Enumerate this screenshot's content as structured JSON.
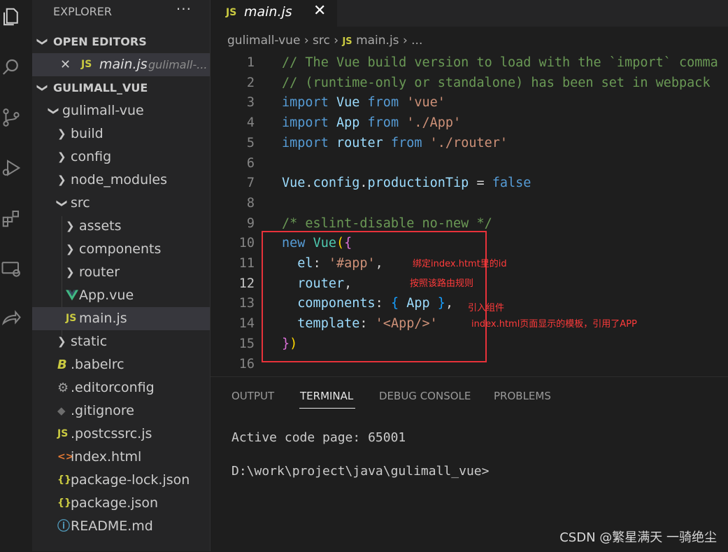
{
  "explorer": {
    "title": "EXPLORER",
    "more": "···",
    "open_editors_header": "OPEN EDITORS",
    "open_editor": {
      "icon": "JS",
      "name": "main.js",
      "path": "gulimall-..."
    },
    "project_header": "GULIMALL_VUE",
    "tree": [
      {
        "label": "gulimall-vue",
        "kind": "folder",
        "open": true
      },
      {
        "label": "build",
        "kind": "folder",
        "open": false
      },
      {
        "label": "config",
        "kind": "folder",
        "open": false
      },
      {
        "label": "node_modules",
        "kind": "folder",
        "open": false
      },
      {
        "label": "src",
        "kind": "folder",
        "open": true
      },
      {
        "label": "assets",
        "kind": "folder",
        "open": false
      },
      {
        "label": "components",
        "kind": "folder",
        "open": false
      },
      {
        "label": "router",
        "kind": "folder",
        "open": false
      },
      {
        "label": "App.vue",
        "kind": "file",
        "icon": "vue-icon"
      },
      {
        "label": "main.js",
        "kind": "file",
        "icon": "JS",
        "selected": true
      },
      {
        "label": "static",
        "kind": "folder",
        "open": false
      },
      {
        "label": ".babelrc",
        "kind": "file",
        "icon": "B"
      },
      {
        "label": ".editorconfig",
        "kind": "file",
        "icon": "gear-icon"
      },
      {
        "label": ".gitignore",
        "kind": "file",
        "icon": "git-icon"
      },
      {
        "label": ".postcssrc.js",
        "kind": "file",
        "icon": "JS"
      },
      {
        "label": "index.html",
        "kind": "file",
        "icon": "<>"
      },
      {
        "label": "package-lock.json",
        "kind": "file",
        "icon": "{}"
      },
      {
        "label": "package.json",
        "kind": "file",
        "icon": "{}"
      },
      {
        "label": "README.md",
        "kind": "file",
        "icon": "info-icon"
      }
    ]
  },
  "editor": {
    "tab": {
      "icon": "JS",
      "name": "main.js",
      "close": "✕"
    },
    "breadcrumb": {
      "root": "gulimall-vue",
      "folder": "src",
      "icon": "JS",
      "file": "main.js",
      "more": "..."
    },
    "current_line": 12,
    "lines": [
      "// The Vue build version to load with the `import` comma",
      "// (runtime-only or standalone) has been set in webpack",
      "import Vue from 'vue'",
      "import App from './App'",
      "import router from './router'",
      "",
      "Vue.config.productionTip = false",
      "",
      "/* eslint-disable no-new */",
      "new Vue({",
      "  el: '#app',",
      "  router,",
      "  components: { App },",
      "  template: '<App/>'",
      "})",
      ""
    ],
    "annotations": [
      "绑定index.htmt里的id",
      "按照该路由规则",
      "引入组件",
      "index.html页面显示的模板，引用了APP"
    ]
  },
  "panel": {
    "tabs": [
      "OUTPUT",
      "TERMINAL",
      "DEBUG CONSOLE",
      "PROBLEMS"
    ],
    "active_tab": "TERMINAL",
    "terminal_lines": [
      "Active code page: 65001",
      "D:\\work\\project\\java\\gulimall_vue>"
    ]
  },
  "watermark": "CSDN @繁星满天 一骑绝尘",
  "colors": {
    "keyword": "#569cd6",
    "string": "#ce9178",
    "comment": "#6a9955",
    "property": "#9cdcfe",
    "class": "#4ec9b0",
    "annotation": "#ff3b3b",
    "box": "#e8323a"
  }
}
